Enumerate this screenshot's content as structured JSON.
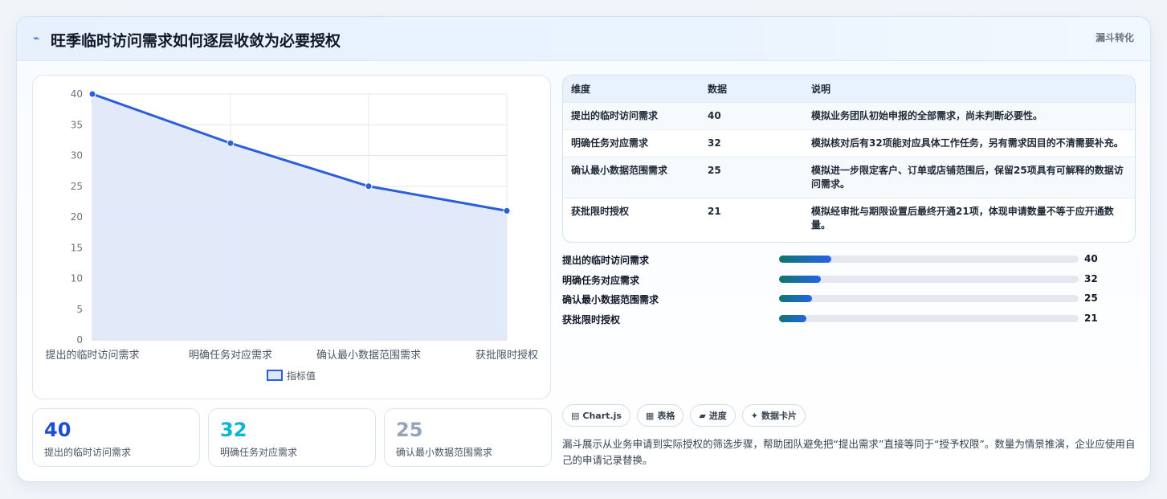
{
  "header": {
    "icon": "lightning-icon",
    "title": "旺季临时访问需求如何逐层收敛为必要授权",
    "tag": "漏斗转化"
  },
  "chart_data": {
    "type": "line",
    "categories": [
      "提出的临时访问需求",
      "明确任务对应需求",
      "确认最小数据范围需求",
      "获批限时授权"
    ],
    "series": [
      {
        "name": "指标值",
        "values": [
          40,
          32,
          25,
          21
        ]
      }
    ],
    "ylim": [
      0,
      40
    ],
    "yticks": [
      "0",
      "5",
      "10",
      "15",
      "20",
      "25",
      "30",
      "35",
      "40"
    ],
    "grid": true,
    "fill": true,
    "legend": "bottom",
    "colors": {
      "line": "#2b5fd9",
      "fill": "#dfe8fa"
    }
  },
  "stats": [
    {
      "value": "40",
      "label": "提出的临时访问需求",
      "color": "#1d4ed8"
    },
    {
      "value": "32",
      "label": "明确任务对应需求",
      "color": "#06b6d4"
    },
    {
      "value": "25",
      "label": "确认最小数据范围需求",
      "color": "#94a3b8"
    }
  ],
  "table": {
    "headers": [
      "维度",
      "数据",
      "说明"
    ],
    "rows": [
      {
        "dim": "提出的临时访问需求",
        "value": "40",
        "desc": "模拟业务团队初始申报的全部需求，尚未判断必要性。"
      },
      {
        "dim": "明确任务对应需求",
        "value": "32",
        "desc": "模拟核对后有32项能对应具体工作任务，另有需求因目的不清需要补充。"
      },
      {
        "dim": "确认最小数据范围需求",
        "value": "25",
        "desc": "模拟进一步限定客户、订单或店铺范围后，保留25项具有可解释的数据访问需求。"
      },
      {
        "dim": "获批限时授权",
        "value": "21",
        "desc": "模拟经审批与期限设置后最终开通21项，体现申请数量不等于应开通数量。"
      }
    ]
  },
  "progress": {
    "max": 40,
    "items": [
      {
        "label": "提出的临时访问需求",
        "value": 40,
        "text": "40"
      },
      {
        "label": "明确任务对应需求",
        "value": 32,
        "text": "32"
      },
      {
        "label": "确认最小数据范围需求",
        "value": 25,
        "text": "25"
      },
      {
        "label": "获批限时授权",
        "value": 21,
        "text": "21"
      }
    ]
  },
  "chips": [
    {
      "icon": "chart-icon",
      "glyph": "▤",
      "label": "Chart.js"
    },
    {
      "icon": "table-icon",
      "glyph": "▦",
      "label": "表格"
    },
    {
      "icon": "progress-icon",
      "glyph": "▰",
      "label": "进度"
    },
    {
      "icon": "sparkle-icon",
      "glyph": "✦",
      "label": "数据卡片"
    }
  ],
  "note": "漏斗展示从业务申请到实际授权的筛选步骤，帮助团队避免把“提出需求”直接等同于“授予权限”。数量为情景推演，企业应使用自己的申请记录替换。"
}
